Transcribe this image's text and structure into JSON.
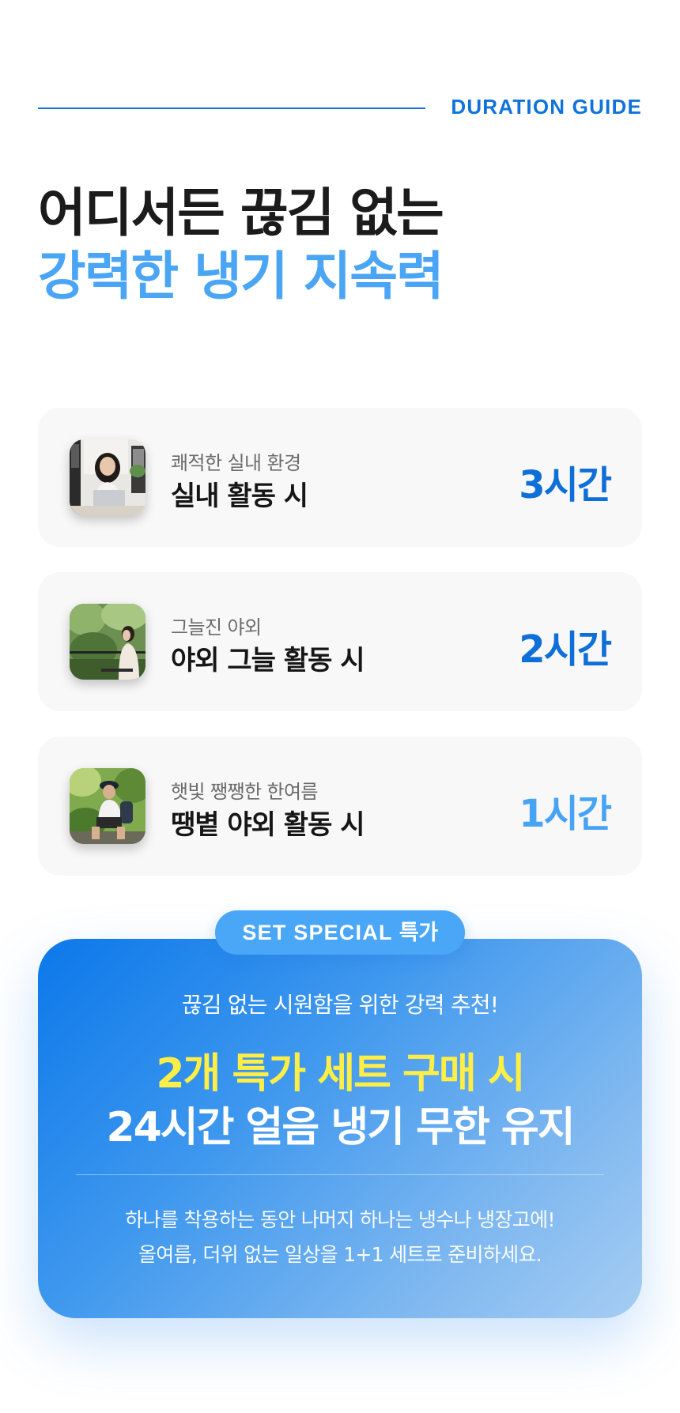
{
  "header": {
    "label": "DURATION GUIDE",
    "headline_line1": "어디서든 끊김 없는",
    "headline_line2": "강력한 냉기 지속력"
  },
  "durations": [
    {
      "subtitle": "쾌적한 실내 환경",
      "title": "실내 활동 시",
      "hours": "3시간",
      "hours_color": "#0f6fd8",
      "image": "woman-with-laptop-indoors-photo"
    },
    {
      "subtitle": "그늘진 야외",
      "title": "야외 그늘 활동 시",
      "hours": "2시간",
      "hours_color": "#0f6fd8",
      "image": "woman-sitting-in-shaded-park-photo"
    },
    {
      "subtitle": "햇빛 쨍쨍한 한여름",
      "title": "땡볕 야외 활동 시",
      "hours": "1시간",
      "hours_color": "#47a3f3",
      "image": "hiker-resting-in-sunny-forest-photo"
    }
  ],
  "promo": {
    "badge_en": "SET SPECIAL",
    "badge_ko": "특가",
    "lead": "끊김 없는 시원함을 위한 강력 추천!",
    "headline1": "2개 특가 세트 구매 시",
    "headline2": "24시간 얼음 냉기 무한 유지",
    "note1": "하나를 착용하는 동안 나머지 하나는 냉수나 냉장고에!",
    "note2": "올여름, 더위 없는 일상을 1+1 세트로 준비하세요.",
    "accent_yellow": "#ffee45",
    "gradient_start": "#0c78ea",
    "gradient_end": "#a6cdf3"
  }
}
